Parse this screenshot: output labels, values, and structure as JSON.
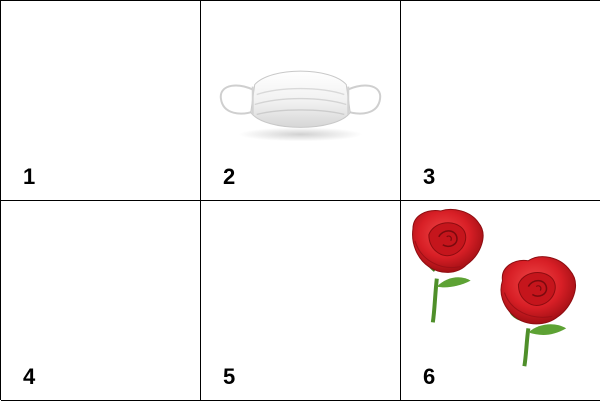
{
  "grid": {
    "cells": [
      {
        "number": "1",
        "content": ""
      },
      {
        "number": "2",
        "content": "face-mask"
      },
      {
        "number": "3",
        "content": ""
      },
      {
        "number": "4",
        "content": ""
      },
      {
        "number": "5",
        "content": ""
      },
      {
        "number": "6",
        "content": "two-red-roses"
      }
    ]
  },
  "colors": {
    "border": "#000000",
    "background": "#ffffff",
    "rose_red": "#d81f26",
    "stem_green": "#4f8f2a"
  }
}
